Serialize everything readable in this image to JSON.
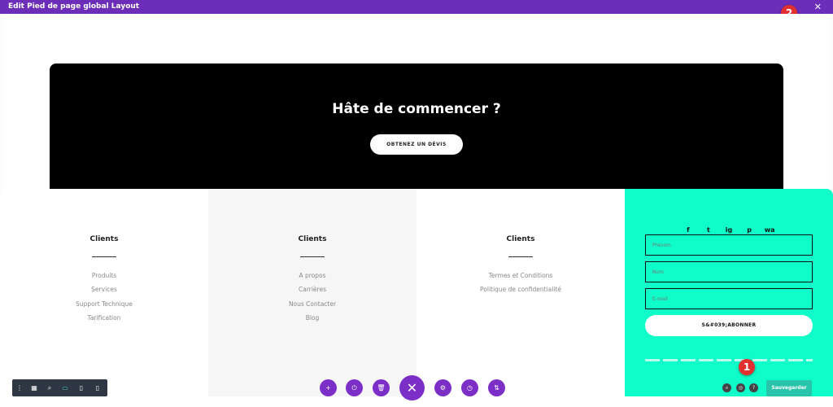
{
  "window": {
    "title": "Edit Pied de page global Layout",
    "close_glyph": "✕"
  },
  "annotations": {
    "one": "1",
    "two": "2"
  },
  "cta": {
    "title": "Hâte de commencer ?",
    "button": "OBTENEZ UN DÉVIS"
  },
  "columns": [
    {
      "title": "Clients",
      "links": [
        "Produits",
        "Services",
        "Support Technique",
        "Tarification"
      ]
    },
    {
      "title": "Clients",
      "links": [
        "A propos",
        "Carrières",
        "Nous Contacter",
        "Blog"
      ]
    },
    {
      "title": "Clients",
      "links": [
        "Termes et Conditions",
        "Politique de confidentialité"
      ]
    }
  ],
  "newsletter": {
    "social": [
      "f",
      "t",
      "ig",
      "p",
      "wa"
    ],
    "firstname_placeholder": "Prénom",
    "name_placeholder": "Nom",
    "email_placeholder": "E-mail",
    "subscribe": "S&#039;ABONNER"
  },
  "save": {
    "label": "Sauvegarder"
  },
  "colors": {
    "accent": "#6c2eb9",
    "teal": "#0ffdc9",
    "save": "#29c4a9",
    "badge": "#e1302f"
  },
  "toolbar_left": {
    "icons": [
      "more-icon",
      "wireframe-icon",
      "zoom-icon",
      "desktop-icon",
      "tablet-icon",
      "phone-icon"
    ]
  },
  "toolbar_center": {
    "icons": [
      "add-icon",
      "power-icon",
      "trash-icon",
      "close-icon",
      "settings-icon",
      "history-icon",
      "portability-icon"
    ]
  }
}
